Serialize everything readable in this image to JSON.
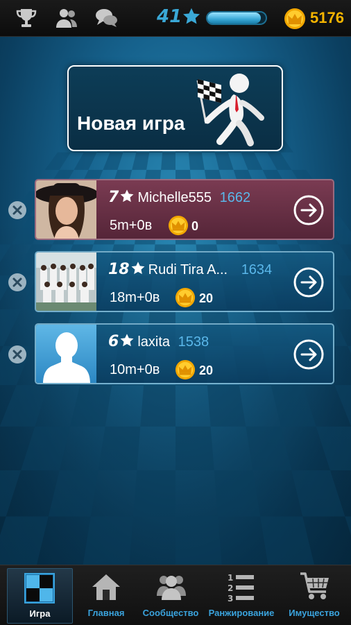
{
  "top_bar": {
    "icons": [
      "trophy-icon",
      "friends-icon",
      "chat-icon"
    ],
    "level": "41",
    "star_icon": "star-icon",
    "xp_fraction": 0.92,
    "coin_icon": "crown-coin-icon",
    "coins": "5176"
  },
  "new_game": {
    "label": "Новая игра",
    "art": "stickman-checkered-flag-illustration"
  },
  "games": [
    {
      "level": "7",
      "name": "Michelle555",
      "rating": "1662",
      "time_control": "5m+0в",
      "bet": "0",
      "avatar": "woman-in-hat-photo",
      "highlight": "red"
    },
    {
      "level": "18",
      "name": "Rudi Tira A...",
      "rating": "1634",
      "time_control": "18m+0в",
      "bet": "20",
      "avatar": "group-photo",
      "highlight": "blue"
    },
    {
      "level": "6",
      "name": "laxita",
      "rating": "1538",
      "time_control": "10m+0в",
      "bet": "20",
      "avatar": "default-silhouette",
      "highlight": "blue"
    }
  ],
  "nav": {
    "items": [
      {
        "label": "Игра",
        "icon": "chessboard-icon",
        "active": true
      },
      {
        "label": "Главная",
        "icon": "home-icon",
        "active": false
      },
      {
        "label": "Сообщество",
        "icon": "community-icon",
        "active": false
      },
      {
        "label": "Ранжирование",
        "icon": "ranking-icon",
        "active": false
      },
      {
        "label": "Имущество",
        "icon": "shop-cart-icon",
        "active": false
      }
    ]
  },
  "colors": {
    "accent": "#3aa8d6",
    "gold": "#f5b400",
    "rating": "#5ab7ea",
    "highlight_card": "#6a3048"
  }
}
